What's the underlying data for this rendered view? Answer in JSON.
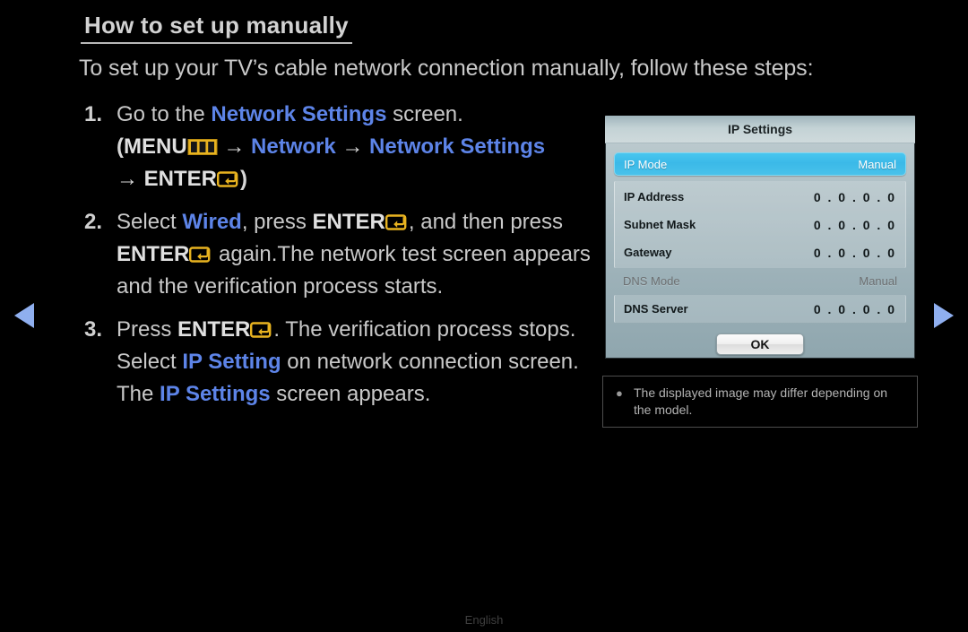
{
  "heading": "How to set up manually",
  "intro": "To set up your TV’s cable network connection manually, follow these steps:",
  "steps": [
    {
      "number": "1.",
      "line1_a": "Go to the ",
      "line1_accent": "Network Settings",
      "line1_b": " screen.",
      "line2_open": "(",
      "line2_menu": "MENU",
      "line2_arrow1": " → ",
      "line2_network": "Network",
      "line2_arrow2": " → ",
      "line2_netsettings": "Network Settings",
      "line3_arrow": "→ ",
      "line3_enter": "ENTER",
      "line3_close": ")"
    },
    {
      "number": "2.",
      "a": "Select ",
      "accent": "Wired",
      "b": ", press ",
      "enter1": "ENTER",
      "c": ", and then press ",
      "enter2": "ENTER",
      "d": " again.The network test screen appears and the verification process starts."
    },
    {
      "number": "3.",
      "a": "Press ",
      "enter": "ENTER",
      "b": ". The verification process stops. Select ",
      "accent1": "IP Setting",
      "c": " on network connection screen. The ",
      "accent2": "IP Settings",
      "d": " screen appears."
    }
  ],
  "ip_settings": {
    "title": "IP Settings",
    "selected_row": {
      "key": "IP Mode",
      "value": "Manual"
    },
    "rows": [
      {
        "key": "IP Address",
        "value": "0 . 0 . 0 . 0"
      },
      {
        "key": "Subnet Mask",
        "value": "0 . 0 . 0 . 0"
      },
      {
        "key": "Gateway",
        "value": "0 . 0 . 0 . 0"
      }
    ],
    "dns_mode": {
      "key": "DNS Mode",
      "value": "Manual"
    },
    "dns_server": {
      "key": "DNS Server",
      "value": "0 . 0 . 0 . 0"
    },
    "ok_label": "OK"
  },
  "note": {
    "bullet": "●",
    "text": "The displayed image may differ depending on the model."
  },
  "nav": {
    "prev_icon": "triangle-left-icon",
    "next_icon": "triangle-right-icon"
  },
  "footer": {
    "language": "English"
  },
  "colors": {
    "accent_blue": "#5d84e8",
    "key_icon_gold": "#e8b320",
    "selection_cyan": "#3bb9e8",
    "nav_arrow_blue": "#8fafef",
    "background": "#000000"
  }
}
